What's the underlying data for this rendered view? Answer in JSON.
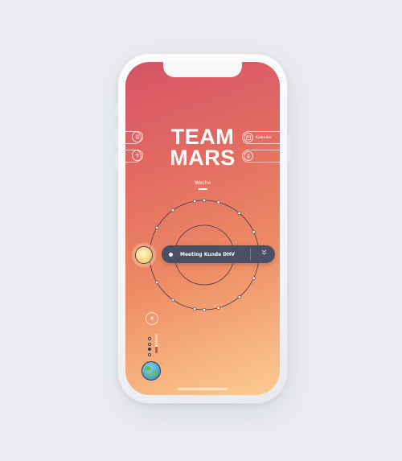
{
  "app": {
    "title_line1": "TEAM",
    "title_line2": "MARS"
  },
  "view_tab": {
    "label": "Woche"
  },
  "left_controls": {
    "list_icon": "list-icon",
    "add_icon": "plus-icon",
    "add_symbol": "+"
  },
  "right_controls": {
    "calendar_label": "Kalender",
    "calendar_icon": "calendar-icon",
    "mic_icon": "microphone-icon"
  },
  "event": {
    "label": "Meeting Kunde DHV",
    "expand_icon": "chevron-double-down-icon",
    "expand_symbol": "»"
  },
  "close": {
    "icon": "close-icon",
    "symbol": "✕"
  },
  "colors": {
    "gradient_top": "#d35466",
    "gradient_bottom": "#fbca93",
    "event_pill": "#4b4f63",
    "accent_red": "#d94a5a",
    "sun": "#f8d98a"
  }
}
